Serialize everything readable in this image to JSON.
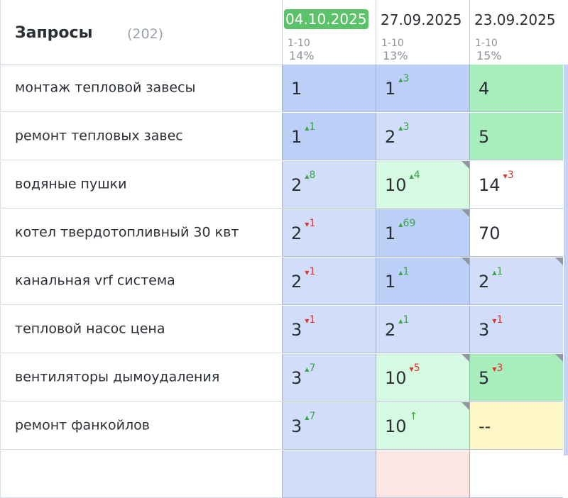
{
  "header": {
    "title": "Запросы",
    "count": "(202)",
    "dates": [
      {
        "date": "04.10.2025",
        "range": "1-10",
        "pct": "14%",
        "active": true
      },
      {
        "date": "27.09.2025",
        "range": "1-10",
        "pct": "13%",
        "active": false
      },
      {
        "date": "23.09.2025",
        "range": "1-10",
        "pct": "15%",
        "active": false
      }
    ]
  },
  "rows": [
    {
      "query": "монтаж тепловой завесы",
      "cells": [
        {
          "pos": "1",
          "delta": "",
          "dir": "",
          "color": "#bcd0f7",
          "corner": false
        },
        {
          "pos": "1",
          "delta": "3",
          "dir": "up",
          "color": "#bcd0f7",
          "corner": false
        },
        {
          "pos": "4",
          "delta": "",
          "dir": "",
          "color": "#a8eebd",
          "corner": false
        }
      ]
    },
    {
      "query": "ремонт тепловых завес",
      "cells": [
        {
          "pos": "1",
          "delta": "1",
          "dir": "up",
          "color": "#bcd0f7",
          "corner": false
        },
        {
          "pos": "2",
          "delta": "3",
          "dir": "up",
          "color": "#d2def9",
          "corner": false
        },
        {
          "pos": "5",
          "delta": "",
          "dir": "",
          "color": "#a8eebd",
          "corner": false
        }
      ]
    },
    {
      "query": "водяные пушки",
      "cells": [
        {
          "pos": "2",
          "delta": "8",
          "dir": "up",
          "color": "#d2def9",
          "corner": false
        },
        {
          "pos": "10",
          "delta": "4",
          "dir": "up",
          "color": "#d6fae1",
          "corner": true
        },
        {
          "pos": "14",
          "delta": "3",
          "dir": "down",
          "color": "#ffffff",
          "corner": false
        }
      ]
    },
    {
      "query": "котел твердотопливный 30 квт",
      "cells": [
        {
          "pos": "2",
          "delta": "1",
          "dir": "down",
          "color": "#d2def9",
          "corner": false
        },
        {
          "pos": "1",
          "delta": "69",
          "dir": "up",
          "color": "#bcd0f7",
          "corner": true
        },
        {
          "pos": "70",
          "delta": "",
          "dir": "",
          "color": "#ffffff",
          "corner": false
        }
      ]
    },
    {
      "query": "канальная vrf система",
      "cells": [
        {
          "pos": "2",
          "delta": "1",
          "dir": "down",
          "color": "#d2def9",
          "corner": false
        },
        {
          "pos": "1",
          "delta": "1",
          "dir": "up",
          "color": "#bcd0f7",
          "corner": true
        },
        {
          "pos": "2",
          "delta": "1",
          "dir": "up",
          "color": "#d2def9",
          "corner": true
        }
      ]
    },
    {
      "query": "тепловой насос цена",
      "cells": [
        {
          "pos": "3",
          "delta": "1",
          "dir": "down",
          "color": "#d2def9",
          "corner": false
        },
        {
          "pos": "2",
          "delta": "1",
          "dir": "up",
          "color": "#d2def9",
          "corner": false
        },
        {
          "pos": "3",
          "delta": "1",
          "dir": "down",
          "color": "#d2def9",
          "corner": false
        }
      ]
    },
    {
      "query": "вентиляторы дымоудаления",
      "cells": [
        {
          "pos": "3",
          "delta": "7",
          "dir": "up",
          "color": "#d2def9",
          "corner": false
        },
        {
          "pos": "10",
          "delta": "5",
          "dir": "down",
          "color": "#d6fae1",
          "corner": true
        },
        {
          "pos": "5",
          "delta": "3",
          "dir": "down",
          "color": "#a8eebd",
          "corner": true
        }
      ]
    },
    {
      "query": "ремонт фанкойлов",
      "cells": [
        {
          "pos": "3",
          "delta": "7",
          "dir": "up",
          "color": "#d2def9",
          "corner": false
        },
        {
          "pos": "10",
          "delta": "↑",
          "dir": "up",
          "color": "#d6fae1",
          "corner": true
        },
        {
          "pos": "--",
          "delta": "",
          "dir": "",
          "color": "#fdf6c6",
          "corner": false
        }
      ]
    }
  ],
  "partial_row_colors": [
    "#d2def9",
    "#fbe6e6",
    "#ffffff"
  ],
  "icons": {
    "up": "triangle-up-icon",
    "down": "triangle-down-icon",
    "corner": "corner-flag-icon"
  }
}
